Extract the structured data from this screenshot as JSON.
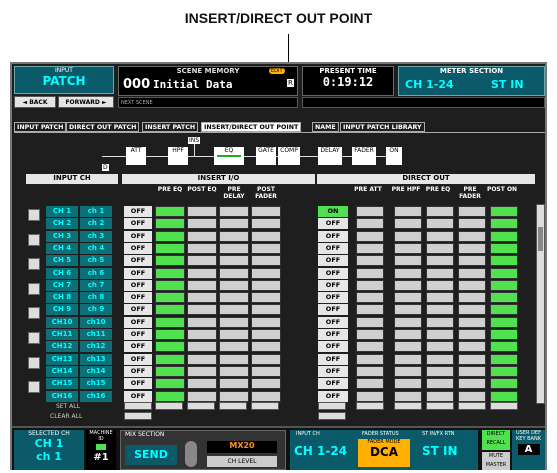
{
  "callout": "INSERT/DIRECT OUT POINT",
  "top": {
    "input_label": "INPUT",
    "patch": "PATCH",
    "back": "◄ BACK",
    "forward": "FORWARD ►",
    "scene_memory_label": "SCENE MEMORY",
    "scene_number": "000",
    "scene_name": "Initial Data",
    "edit_badge": "EDIT",
    "r_badge": "R",
    "next_scene": "NEXT SCENE",
    "present_time_label": "PRESENT TIME",
    "present_time": "0:19:12",
    "meter_label": "METER SECTION",
    "meter_ch": "CH 1-24",
    "meter_stin": "ST IN"
  },
  "tabs": [
    "INPUT PATCH",
    "DIRECT OUT PATCH",
    "INSERT PATCH",
    "INSERT/DIRECT OUT POINT",
    "NAME",
    "INPUT PATCH LIBRARY"
  ],
  "signal_flow": {
    "att": "ATT",
    "hpf": "HPF",
    "ins": "INS",
    "eq": "EQ",
    "gate": "GATE",
    "comp": "COMP",
    "delay": "DELAY",
    "fader": "FADER",
    "on": "ON",
    "d": "D"
  },
  "input_ch_header": "INPUT CH",
  "insert_header": "INSERT I/O",
  "insert_cols": [
    "PRE EQ",
    "POST EQ",
    "PRE DELAY",
    "POST FADER"
  ],
  "direct_header": "DIRECT OUT",
  "direct_cols": [
    "PRE ATT",
    "PRE HPF",
    "PRE EQ",
    "PRE FADER",
    "POST ON"
  ],
  "channels": [
    {
      "ch": "CH 1",
      "name": "ch 1",
      "insert": "OFF",
      "direct": "ON"
    },
    {
      "ch": "CH 2",
      "name": "ch 2",
      "insert": "OFF",
      "direct": "OFF"
    },
    {
      "ch": "CH 3",
      "name": "ch 3",
      "insert": "OFF",
      "direct": "OFF"
    },
    {
      "ch": "CH 4",
      "name": "ch 4",
      "insert": "OFF",
      "direct": "OFF"
    },
    {
      "ch": "CH 5",
      "name": "ch 5",
      "insert": "OFF",
      "direct": "OFF"
    },
    {
      "ch": "CH 6",
      "name": "ch 6",
      "insert": "OFF",
      "direct": "OFF"
    },
    {
      "ch": "CH 7",
      "name": "ch 7",
      "insert": "OFF",
      "direct": "OFF"
    },
    {
      "ch": "CH 8",
      "name": "ch 8",
      "insert": "OFF",
      "direct": "OFF"
    },
    {
      "ch": "CH 9",
      "name": "ch 9",
      "insert": "OFF",
      "direct": "OFF"
    },
    {
      "ch": "CH10",
      "name": "ch10",
      "insert": "OFF",
      "direct": "OFF"
    },
    {
      "ch": "CH11",
      "name": "ch11",
      "insert": "OFF",
      "direct": "OFF"
    },
    {
      "ch": "CH12",
      "name": "ch12",
      "insert": "OFF",
      "direct": "OFF"
    },
    {
      "ch": "CH13",
      "name": "ch13",
      "insert": "OFF",
      "direct": "OFF"
    },
    {
      "ch": "CH14",
      "name": "ch14",
      "insert": "OFF",
      "direct": "OFF"
    },
    {
      "ch": "CH15",
      "name": "ch15",
      "insert": "OFF",
      "direct": "OFF"
    },
    {
      "ch": "CH16",
      "name": "ch16",
      "insert": "OFF",
      "direct": "OFF"
    }
  ],
  "set_all": "SET ALL",
  "clear_all": "CLEAR ALL",
  "bottom": {
    "selected_label": "SELECTED CH",
    "selected_ch": "CH 1",
    "selected_name": "ch 1",
    "machine_label": "MACHINE ID",
    "machine_id": "#1",
    "mix_label": "MIX SECTION",
    "send": "SEND",
    "mix_target": "MX20",
    "ch_level": "CH LEVEL",
    "input_ch_label": "INPUT CH",
    "fader_status_label": "FADER STATUS",
    "fader_mode_label": "FADER MODE",
    "stin_label": "ST IN/FX RTN",
    "ch_range": "CH 1-24",
    "dca": "DCA",
    "stin": "ST IN",
    "direct_recall": "DIRECT RECALL",
    "mute_master": "MUTE MASTER",
    "user_def": "USER DEF KEY BANK",
    "bank": "A"
  },
  "colors": {
    "green": "#50e050",
    "cyan": "#00ffff",
    "teal": "#0f6f77",
    "orange": "#ffb000"
  }
}
